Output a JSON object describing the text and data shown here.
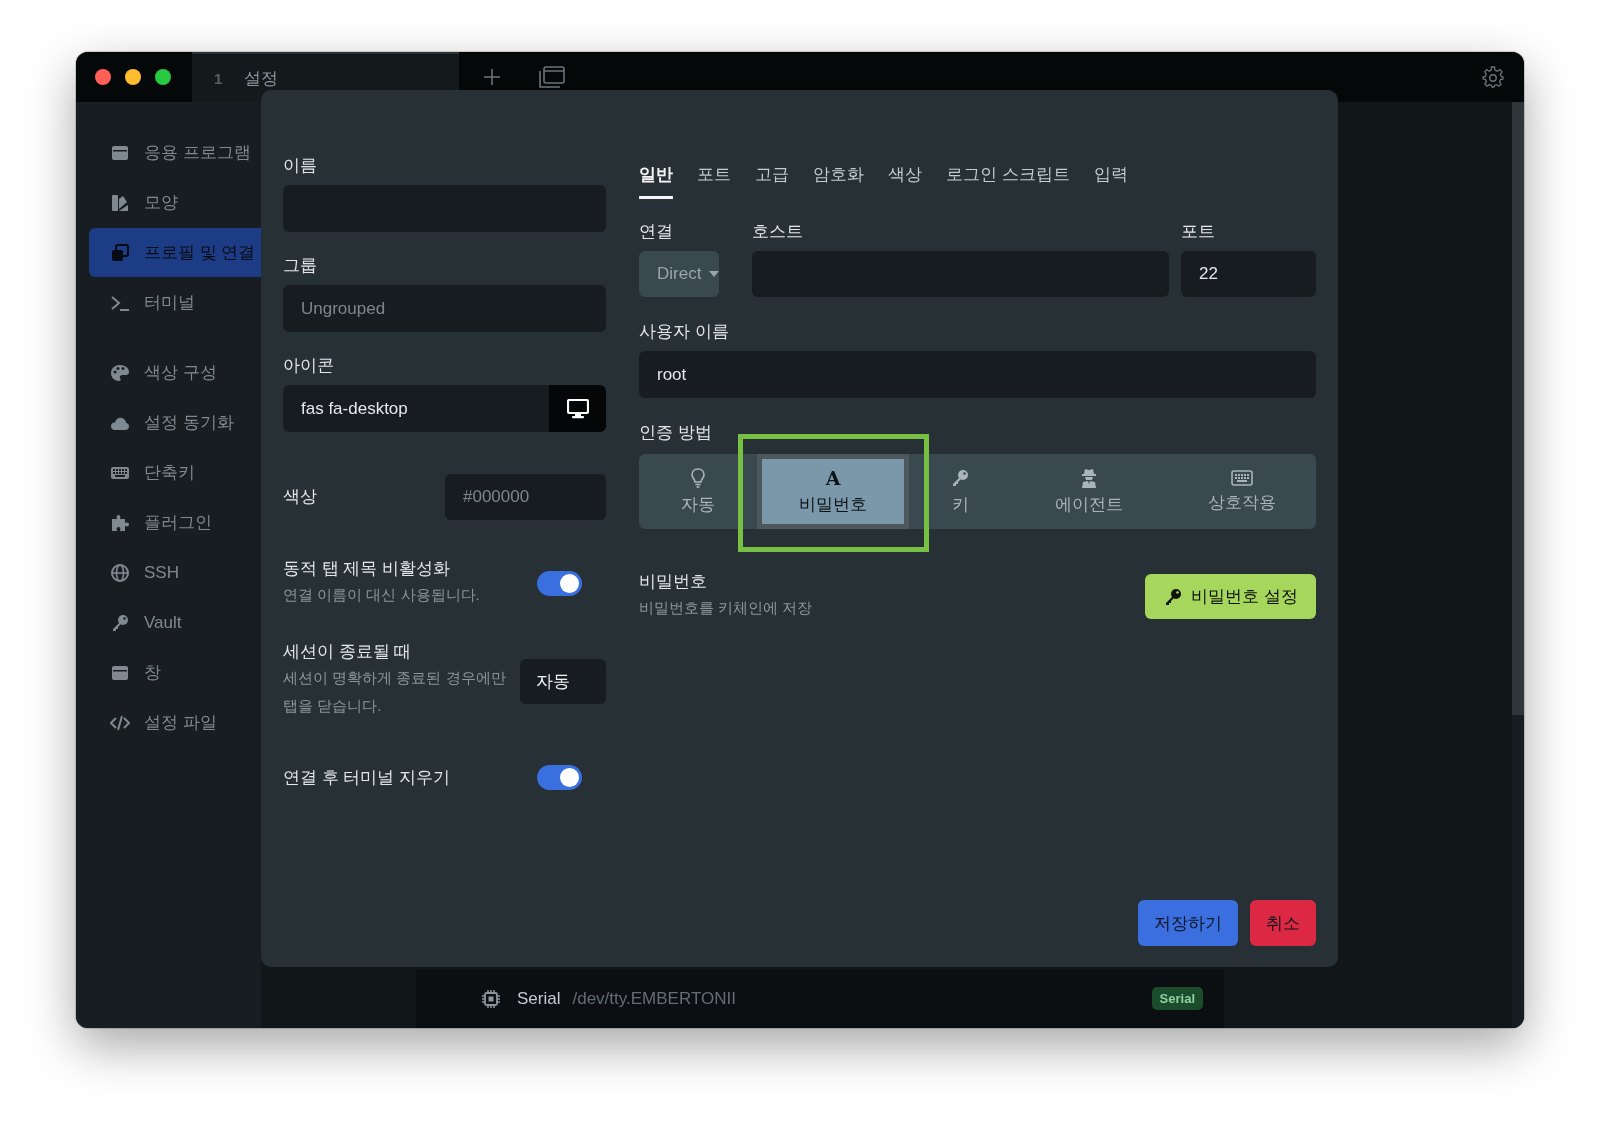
{
  "window": {
    "tab_number": "1",
    "tab_title": "설정"
  },
  "sidebar": {
    "groups": [
      {
        "items": [
          {
            "label": "응용 프로그램",
            "selected": false
          },
          {
            "label": "모양",
            "selected": false
          },
          {
            "label": "프로필 및 연결",
            "selected": true
          },
          {
            "label": "터미널",
            "selected": false
          }
        ]
      },
      {
        "items": [
          {
            "label": "색상 구성",
            "selected": false
          },
          {
            "label": "설정 동기화",
            "selected": false
          },
          {
            "label": "단축키",
            "selected": false
          },
          {
            "label": "플러그인",
            "selected": false
          },
          {
            "label": "SSH",
            "selected": false
          },
          {
            "label": "Vault",
            "selected": false
          },
          {
            "label": "창",
            "selected": false
          },
          {
            "label": "설정 파일",
            "selected": false
          }
        ]
      }
    ]
  },
  "dialog": {
    "name": {
      "label": "이름"
    },
    "group": {
      "label": "그룹",
      "placeholder": "Ungrouped"
    },
    "icon": {
      "label": "아이콘",
      "value": "fas fa-desktop"
    },
    "color": {
      "label": "색상",
      "placeholder": "#000000"
    },
    "dynamic_title": {
      "title": "동적 탭 제목 비활성화",
      "description": "연결 이름이 대신 사용됩니다.",
      "on": true
    },
    "on_session_end": {
      "title": "세션이 종료될 때",
      "description": "세션이 명확하게 종료된 경우에만 탭을 닫습니다.",
      "value": "자동"
    },
    "clear_terminal": {
      "title": "연결 후 터미널 지우기",
      "on": true
    },
    "tabs": [
      {
        "label": "일반",
        "selected": true
      },
      {
        "label": "포트",
        "selected": false
      },
      {
        "label": "고급",
        "selected": false
      },
      {
        "label": "암호화",
        "selected": false
      },
      {
        "label": "색상",
        "selected": false
      },
      {
        "label": "로그인 스크립트",
        "selected": false
      },
      {
        "label": "입력",
        "selected": false
      }
    ],
    "connection": {
      "label": "연결",
      "value": "Direct"
    },
    "host": {
      "label": "호스트"
    },
    "port": {
      "label": "포트",
      "value": "22"
    },
    "username": {
      "label": "사용자 이름",
      "value": "root"
    },
    "auth": {
      "label": "인증 방법",
      "options": [
        {
          "kind": "auto",
          "label": "자동",
          "selected": false
        },
        {
          "kind": "password",
          "glyph": "A",
          "label": "비밀번호",
          "selected": true
        },
        {
          "kind": "key",
          "label": "키",
          "selected": false
        },
        {
          "kind": "agent",
          "label": "에이전트",
          "selected": false
        },
        {
          "kind": "interactive",
          "label": "상호작용",
          "selected": false
        }
      ]
    },
    "password": {
      "title": "비밀번호",
      "description": "비밀번호를 키체인에 저장",
      "button": "비밀번호 설정"
    },
    "buttons": {
      "save": "저장하기",
      "cancel": "취소"
    }
  },
  "status_bar": {
    "type": "Serial",
    "path": "/dev/tty.EMBERTONII",
    "badge": "Serial"
  }
}
